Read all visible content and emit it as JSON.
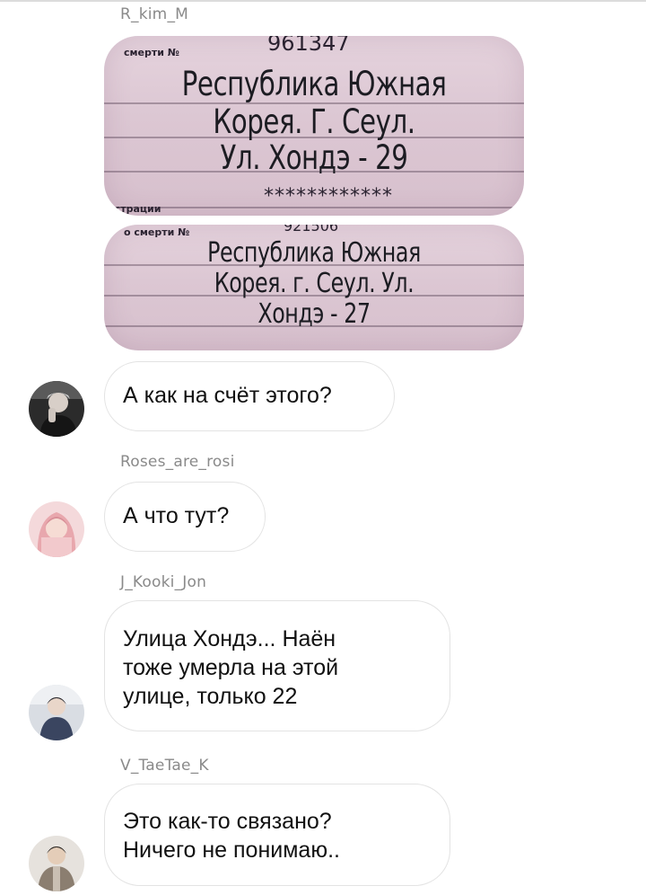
{
  "messages": [
    {
      "sender": "R_kim_M",
      "photos": [
        {
          "header_label": "смерти №",
          "header_number": "961347",
          "lines": [
            "Республика Южная",
            "Корея. Г. Сеул.",
            "Ул. Хондэ - 29"
          ],
          "footer_mask": "************",
          "footer_label": "истрации"
        },
        {
          "header_label": "о смерти №",
          "header_number": "921506",
          "lines": [
            "Республика Южная",
            "Корея. г. Сеул. Ул.",
            "Хондэ - 27"
          ]
        }
      ],
      "text": "А как на счёт этого?"
    },
    {
      "sender": "Roses_are_rosi",
      "text": "А что тут?"
    },
    {
      "sender": "J_Kooki_Jon",
      "text": "Улица Хондэ... Наён\nтоже умерла на этой\nулице, только 22"
    },
    {
      "sender": "V_TaeTae_K",
      "text": "Это как-то связано?\nНичего не понимаю.."
    }
  ]
}
